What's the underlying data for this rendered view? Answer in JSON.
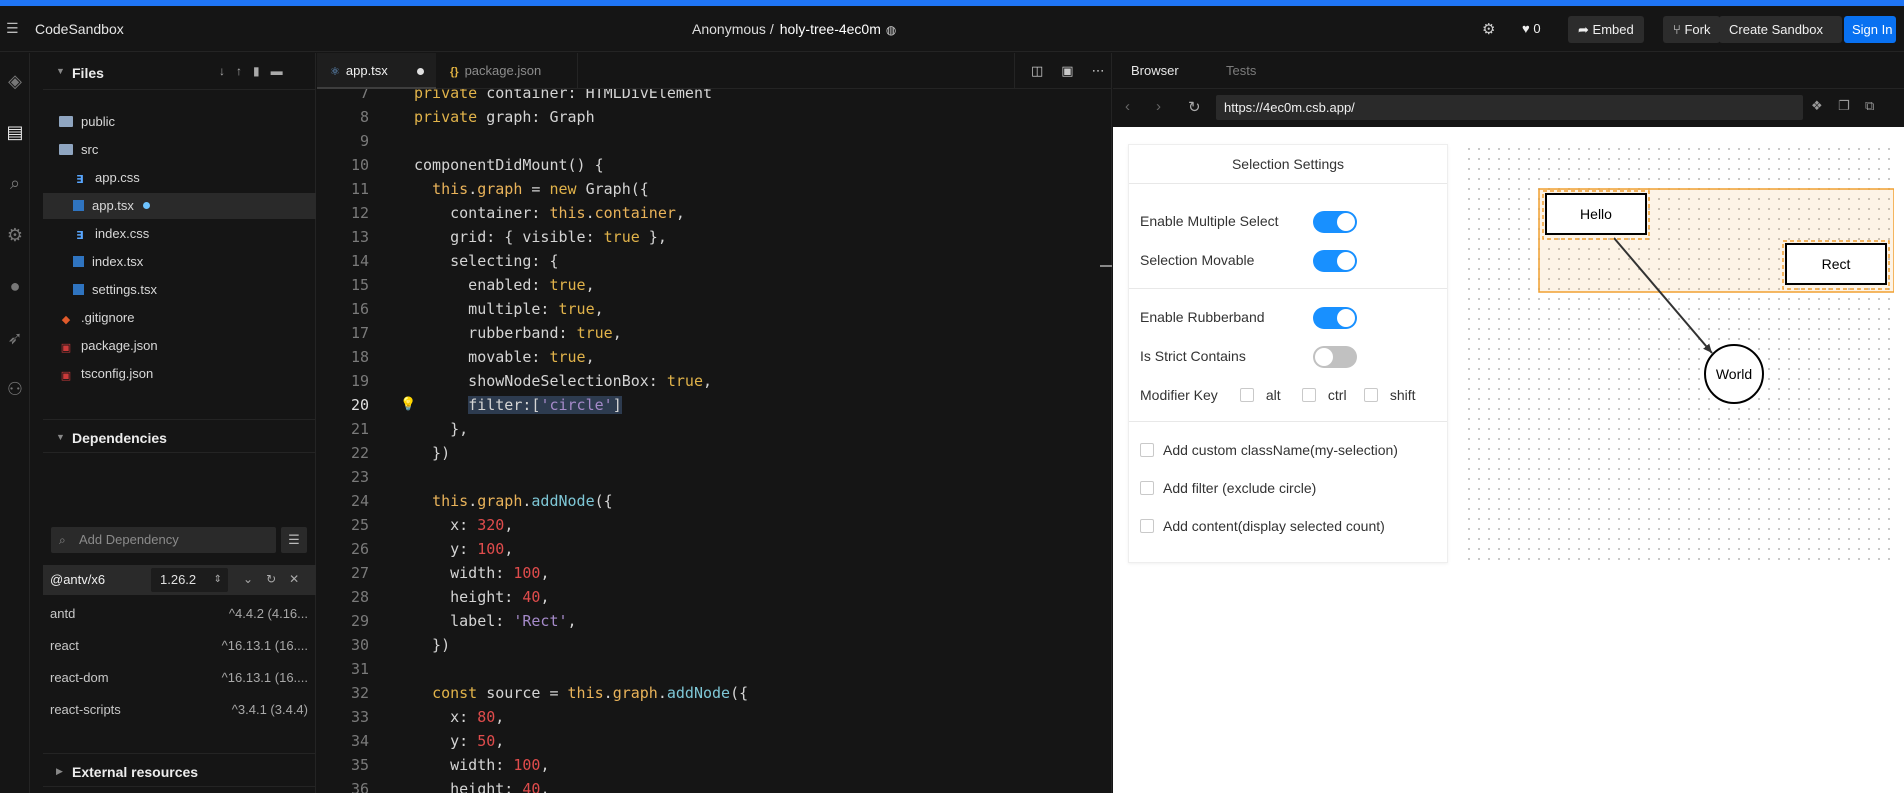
{
  "topbar": {
    "brand": "CodeSandbox",
    "owner": "Anonymous /",
    "sandbox_name": "holy-tree-4ec0m",
    "likes": "0",
    "embed_label": "Embed",
    "fork_label": "Fork",
    "create_label": "Create Sandbox",
    "signin_label": "Sign In"
  },
  "files": {
    "title": "Files",
    "items": [
      {
        "label": "public",
        "icon": "folder-icon"
      },
      {
        "label": "src",
        "icon": "folder-open-icon"
      },
      {
        "label": "app.css",
        "icon": "css-file-icon"
      },
      {
        "label": "app.tsx",
        "icon": "tsx-file-icon"
      },
      {
        "label": "index.css",
        "icon": "css-file-icon"
      },
      {
        "label": "index.tsx",
        "icon": "tsx-file-icon"
      },
      {
        "label": "settings.tsx",
        "icon": "tsx-file-icon"
      },
      {
        "label": ".gitignore",
        "icon": "git-file-icon"
      },
      {
        "label": "package.json",
        "icon": "json-file-icon"
      },
      {
        "label": "tsconfig.json",
        "icon": "json-file-icon"
      }
    ]
  },
  "dependencies": {
    "title": "Dependencies",
    "placeholder": "Add Dependency",
    "main": {
      "name": "@antv/x6",
      "version": "1.26.2"
    },
    "list": [
      {
        "name": "antd",
        "version": "^4.4.2 (4.16..."
      },
      {
        "name": "react",
        "version": "^16.13.1 (16...."
      },
      {
        "name": "react-dom",
        "version": "^16.13.1 (16...."
      },
      {
        "name": "react-scripts",
        "version": "^3.4.1 (3.4.4)"
      }
    ]
  },
  "external": {
    "title": "External resources"
  },
  "editor": {
    "tabs": [
      {
        "label": "app.tsx",
        "modified": true
      },
      {
        "label": "package.json",
        "modified": false
      }
    ],
    "current_line": "20",
    "lines": [
      {
        "n": "7",
        "t": "private container: HTMLDivElement"
      },
      {
        "n": "8",
        "t": "private graph: Graph"
      },
      {
        "n": "9",
        "t": ""
      },
      {
        "n": "10",
        "t": "componentDidMount() {"
      },
      {
        "n": "11",
        "t": "  this.graph = new Graph({"
      },
      {
        "n": "12",
        "t": "    container: this.container,"
      },
      {
        "n": "13",
        "t": "    grid: { visible: true },"
      },
      {
        "n": "14",
        "t": "    selecting: {"
      },
      {
        "n": "15",
        "t": "      enabled: true,"
      },
      {
        "n": "16",
        "t": "      multiple: true,"
      },
      {
        "n": "17",
        "t": "      rubberband: true,"
      },
      {
        "n": "18",
        "t": "      movable: true,"
      },
      {
        "n": "19",
        "t": "      showNodeSelectionBox: true,"
      },
      {
        "n": "20",
        "t": "      filter:['circle']"
      },
      {
        "n": "21",
        "t": "    },"
      },
      {
        "n": "22",
        "t": "  })"
      },
      {
        "n": "23",
        "t": ""
      },
      {
        "n": "24",
        "t": "  this.graph.addNode({"
      },
      {
        "n": "25",
        "t": "    x: 320,"
      },
      {
        "n": "26",
        "t": "    y: 100,"
      },
      {
        "n": "27",
        "t": "    width: 100,"
      },
      {
        "n": "28",
        "t": "    height: 40,"
      },
      {
        "n": "29",
        "t": "    label: 'Rect',"
      },
      {
        "n": "30",
        "t": "  })"
      },
      {
        "n": "31",
        "t": ""
      },
      {
        "n": "32",
        "t": "  const source = this.graph.addNode({"
      },
      {
        "n": "33",
        "t": "    x: 80,"
      },
      {
        "n": "34",
        "t": "    y: 50,"
      },
      {
        "n": "35",
        "t": "    width: 100,"
      },
      {
        "n": "36",
        "t": "    height: 40,"
      }
    ]
  },
  "preview": {
    "tabs": [
      "Browser",
      "Tests"
    ],
    "url": "https://4ec0m.csb.app/",
    "panel": {
      "title": "Selection Settings",
      "multi_select": "Enable Multiple Select",
      "movable": "Selection Movable",
      "rubberband": "Enable Rubberband",
      "strict": "Is Strict Contains",
      "modifier": "Modifier Key",
      "mod_alt": "alt",
      "mod_ctrl": "ctrl",
      "mod_shift": "shift",
      "classname": "Add custom className(my-selection)",
      "filter": "Add filter (exclude circle)",
      "content": "Add content(display selected count)"
    },
    "toggles": {
      "multi_select": true,
      "movable": true,
      "rubberband": true,
      "strict": false
    },
    "graph": {
      "hello": "Hello",
      "rect": "Rect",
      "world": "World"
    },
    "colors": {
      "selection": "#f0a030",
      "switch_on": "#1890ff",
      "accent": "#1f75f5"
    }
  }
}
